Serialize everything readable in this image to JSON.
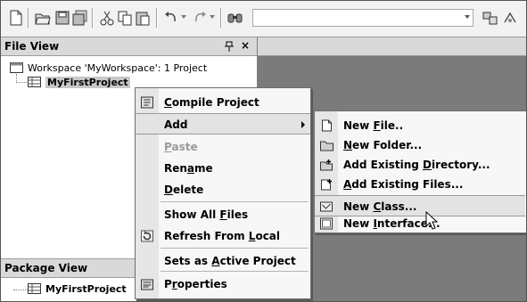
{
  "toolbar": {
    "buttons": [
      {
        "name": "new-file-icon"
      },
      {
        "name": "open-folder-icon"
      },
      {
        "name": "save-icon"
      },
      {
        "name": "save-all-icon"
      },
      {
        "name": "cut-icon"
      },
      {
        "name": "copy-icon"
      },
      {
        "name": "paste-icon"
      },
      {
        "name": "undo-icon"
      },
      {
        "name": "redo-icon"
      },
      {
        "name": "find-icon"
      },
      {
        "name": "build-icon"
      },
      {
        "name": "run-icon"
      }
    ],
    "search_combo_value": ""
  },
  "file_view": {
    "title": "File View",
    "pin_glyph": "p",
    "close_glyph": "×",
    "workspace_label": "Workspace 'MyWorkspace': 1 Project",
    "project_label": "MyFirstProject"
  },
  "package_view": {
    "title": "Package View",
    "project_label": "MyFirstProject"
  },
  "context_menu": {
    "items": [
      {
        "pre": "",
        "ul": "C",
        "post": "ompile Project",
        "icon": "compile-icon",
        "disabled": false
      },
      {
        "pre": "Add",
        "ul": "",
        "post": "",
        "icon": "",
        "disabled": false,
        "submenu": true
      },
      {
        "pre": "",
        "ul": "P",
        "post": "aste",
        "icon": "",
        "disabled": true
      },
      {
        "pre": "Ren",
        "ul": "a",
        "post": "me",
        "icon": "",
        "disabled": false
      },
      {
        "pre": "",
        "ul": "D",
        "post": "elete",
        "icon": "",
        "disabled": false
      },
      {
        "pre": "Show All ",
        "ul": "F",
        "post": "iles",
        "icon": "",
        "disabled": false
      },
      {
        "pre": "Refresh From ",
        "ul": "L",
        "post": "ocal",
        "icon": "refresh-icon",
        "disabled": false
      },
      {
        "pre": "Sets as ",
        "ul": "A",
        "post": "ctive Project",
        "icon": "",
        "disabled": false
      },
      {
        "pre": "P",
        "ul": "r",
        "post": "operties",
        "icon": "properties-icon",
        "disabled": false
      }
    ]
  },
  "add_submenu": {
    "items": [
      {
        "pre": "New ",
        "ul": "F",
        "post": "ile..",
        "icon": "new-file-icon"
      },
      {
        "pre": "",
        "ul": "N",
        "post": "ew Folder...",
        "icon": "folder-icon"
      },
      {
        "pre": "Add Existing ",
        "ul": "D",
        "post": "irectory...",
        "icon": "add-directory-icon"
      },
      {
        "pre": "",
        "ul": "A",
        "post": "dd Existing Files...",
        "icon": "add-files-icon"
      },
      {
        "pre": "New ",
        "ul": "C",
        "post": "lass...",
        "icon": "new-class-icon",
        "highlighted": true
      },
      {
        "pre": "New ",
        "ul": "I",
        "post": "nterface...",
        "icon": "new-interface-icon"
      }
    ]
  },
  "colors": {
    "background_dark": "#7b7b7b",
    "menu_bg": "#f7f7f7",
    "highlight": "#e3e3e3"
  }
}
